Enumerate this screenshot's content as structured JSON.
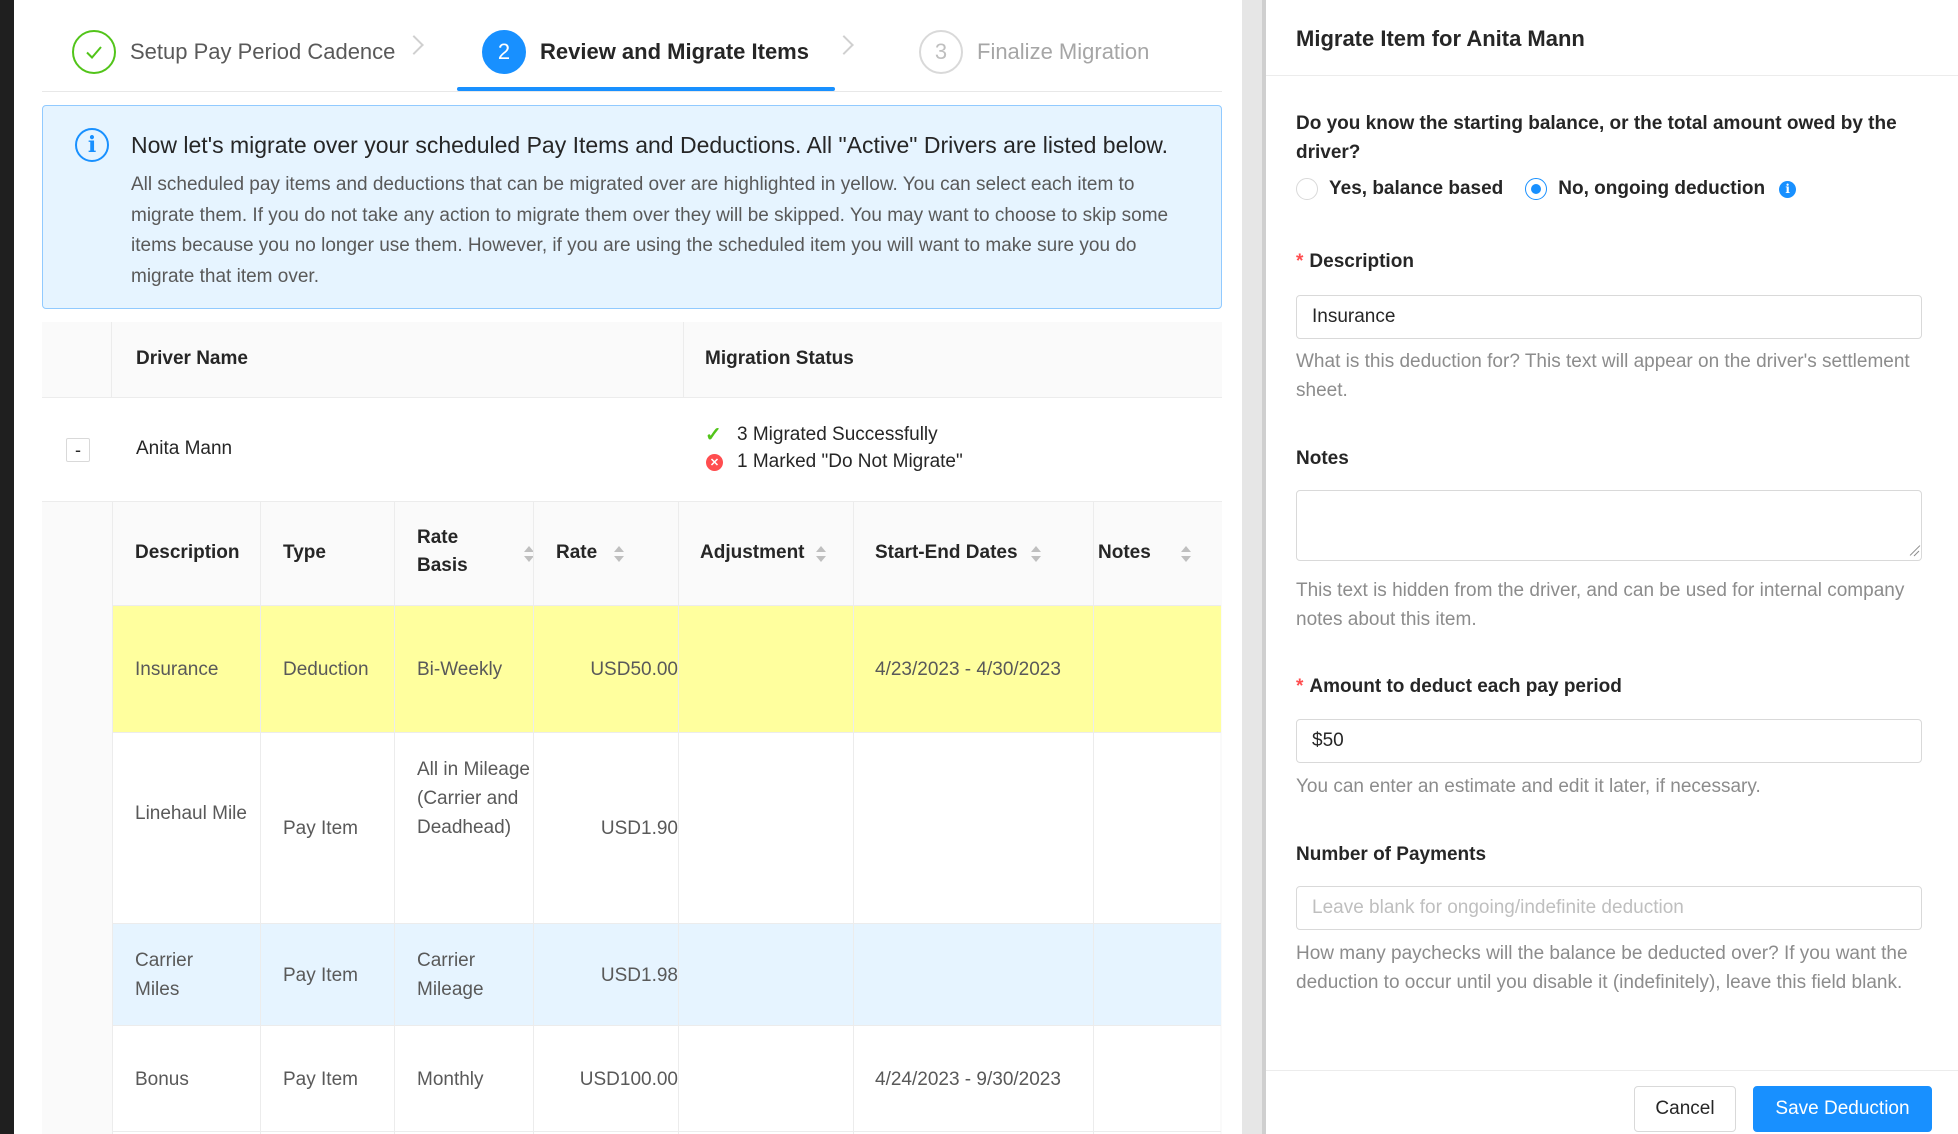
{
  "steps": [
    {
      "number": "1",
      "title": "Setup Pay Period Cadence",
      "status": "done"
    },
    {
      "number": "2",
      "title": "Review and Migrate Items",
      "status": "active"
    },
    {
      "number": "3",
      "title": "Finalize Migration",
      "status": "wait"
    }
  ],
  "alert": {
    "title": "Now let's migrate over your scheduled Pay Items and Deductions. All \"Active\" Drivers are listed below.",
    "body": "All scheduled pay items and deductions that can be migrated over are highlighted in yellow. You can select each item to migrate them. If you do not take any action to migrate them over they will be skipped. You may want to choose to skip some items because you no longer use them. However, if you are using the scheduled item you will want to make sure you do migrate that item over."
  },
  "table": {
    "columns": {
      "driver_name": "Driver Name",
      "migration_status": "Migration Status"
    },
    "driver": {
      "expand_symbol": "-",
      "name": "Anita Mann",
      "status_success": "3 Migrated Successfully",
      "status_skip": "1 Marked \"Do Not Migrate\""
    },
    "items_columns": {
      "description": "Description",
      "type": "Type",
      "rate_basis": "Rate Basis",
      "rate": "Rate",
      "adjustment": "Adjustment",
      "dates": "Start-End Dates",
      "notes": "Notes"
    },
    "items": [
      {
        "description": "Insurance",
        "type": "Deduction",
        "rate_basis": "Bi-Weekly",
        "rate": "USD50.00",
        "adjustment": "",
        "dates": "4/23/2023 - 4/30/2023",
        "notes": "",
        "state": "highlighted"
      },
      {
        "description": "Linehaul Mile",
        "type": "Pay Item",
        "rate_basis": "All in Mileage (Carrier and Deadhead)",
        "rate": "USD1.90",
        "adjustment": "",
        "dates": "",
        "notes": "",
        "state": "normal"
      },
      {
        "description": "Carrier Miles",
        "type": "Pay Item",
        "rate_basis": "Carrier Mileage",
        "rate": "USD1.98",
        "adjustment": "",
        "dates": "",
        "notes": "",
        "state": "hover"
      },
      {
        "description": "Bonus",
        "type": "Pay Item",
        "rate_basis": "Monthly",
        "rate": "USD100.00",
        "adjustment": "",
        "dates": "4/24/2023 - 9/30/2023",
        "notes": "",
        "state": "normal"
      }
    ]
  },
  "drawer": {
    "title": "Migrate Item for Anita Mann",
    "question": "Do you know the starting balance, or the total amount owed by the driver?",
    "options": [
      {
        "label": "Yes, balance based",
        "checked": false
      },
      {
        "label": "No, ongoing deduction",
        "checked": true
      }
    ],
    "description": {
      "label": "Description",
      "value": "Insurance",
      "help": "What is this deduction for? This text will appear on the driver's settlement sheet."
    },
    "notes": {
      "label": "Notes",
      "value": "",
      "help": "This text is hidden from the driver, and can be used for internal company notes about this item."
    },
    "amount": {
      "label": "Amount to deduct each pay period",
      "value": "$50",
      "help": "You can enter an estimate and edit it later, if necessary."
    },
    "payments": {
      "label": "Number of Payments",
      "placeholder": "Leave blank for ongoing/indefinite deduction",
      "help": "How many paychecks will the balance be deducted over? If you want the deduction to occur until you disable it (indefinitely), leave this field blank."
    },
    "buttons": {
      "cancel": "Cancel",
      "save": "Save Deduction"
    }
  },
  "colors": {
    "primary": "#1890ff",
    "success": "#52c41a",
    "error": "#ff4d4f",
    "highlight_row": "#ffff9e",
    "hover_row": "#e6f4ff",
    "alert_bg": "#e6f4ff"
  },
  "icons": {
    "step_done": "check-icon",
    "alert": "info-circle-icon",
    "status_success": "check-icon",
    "status_skip": "close-circle-icon",
    "radio_info": "info-circle-icon",
    "sort": "sort-icon"
  }
}
